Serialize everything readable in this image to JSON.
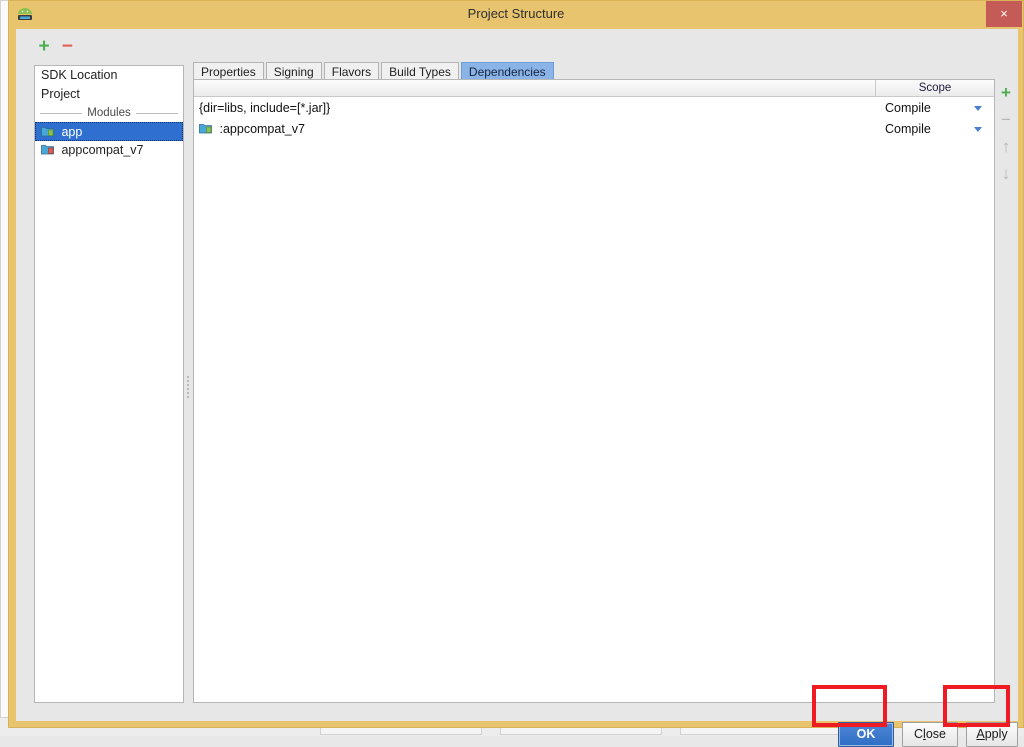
{
  "window": {
    "title": "Project Structure",
    "app_icon": "android-icon",
    "close_label": "×"
  },
  "left_toolbar": {
    "add_label": "+",
    "remove_label": "−"
  },
  "sidebar": {
    "items": [
      {
        "label": "SDK Location",
        "icon": "none",
        "selected": false
      },
      {
        "label": "Project",
        "icon": "none",
        "selected": false
      }
    ],
    "group_label": "Modules",
    "modules": [
      {
        "label": "app",
        "icon": "module-folder-green-icon",
        "selected": true
      },
      {
        "label": "appcompat_v7",
        "icon": "module-folder-red-icon",
        "selected": false
      }
    ]
  },
  "tabs": [
    {
      "label": "Properties",
      "active": false
    },
    {
      "label": "Signing",
      "active": false
    },
    {
      "label": "Flavors",
      "active": false
    },
    {
      "label": "Build Types",
      "active": false
    },
    {
      "label": "Dependencies",
      "active": true
    }
  ],
  "table": {
    "columns": [
      {
        "label": ""
      },
      {
        "label": "Scope"
      }
    ],
    "rows": [
      {
        "name": "{dir=libs, include=[*.jar]}",
        "icon": "none",
        "scope": "Compile"
      },
      {
        "name": ":appcompat_v7",
        "icon": "module-folder-green-icon",
        "scope": "Compile"
      }
    ]
  },
  "dependency_toolbar": {
    "add_label": "+",
    "remove_label": "−",
    "move_up_label": "↑",
    "move_down_label": "↓"
  },
  "buttons": {
    "ok": "OK",
    "close_pre": "C",
    "close_mnemonic": "l",
    "close_post": "ose",
    "apply_mnemonic": "A",
    "apply_post": "pply"
  },
  "annotations": [
    {
      "target": "ok-button",
      "color": "#ef1b22"
    },
    {
      "target": "apply-button",
      "color": "#ef1b22"
    }
  ]
}
